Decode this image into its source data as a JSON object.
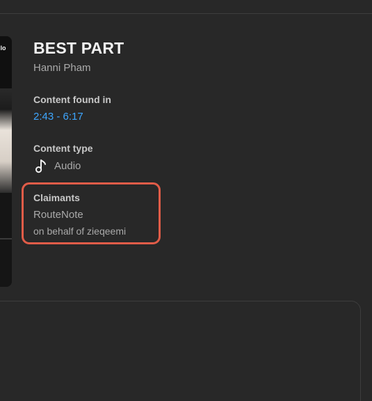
{
  "thumbnail": {
    "overlay_text": "llo"
  },
  "song": {
    "title": "BEST PART",
    "artist": "Hanni Pham"
  },
  "content_found": {
    "label": "Content found in",
    "range": "2:43 - 6:17"
  },
  "content_type": {
    "label": "Content type",
    "icon": "music-note-icon",
    "value": "Audio"
  },
  "claimants": {
    "label": "Claimants",
    "name": "RouteNote",
    "on_behalf": "on behalf of zieqeemi"
  },
  "colors": {
    "background": "#282828",
    "link": "#3ea6ff",
    "highlight_box": "#e05c48",
    "primary_text": "#f1f1f1",
    "secondary_text": "#aaaaaa"
  }
}
